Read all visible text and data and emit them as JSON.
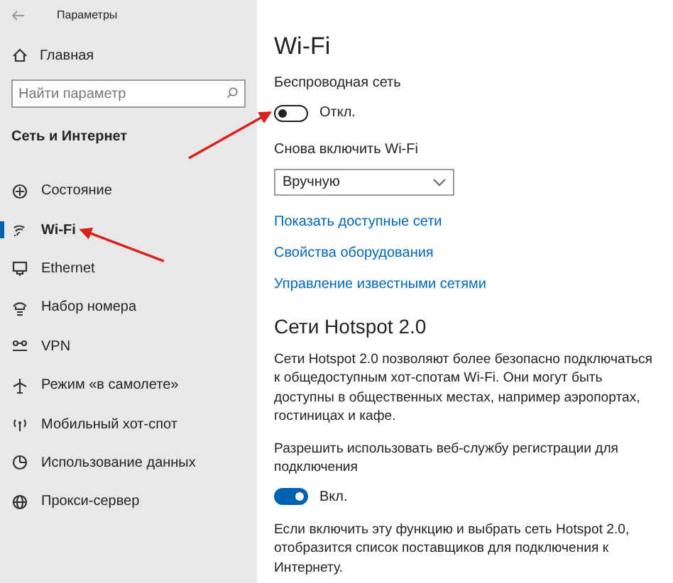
{
  "window": {
    "title": "Параметры"
  },
  "sidebar": {
    "home": "Главная",
    "search": {
      "placeholder": "Найти параметр"
    },
    "section": "Сеть и Интернет",
    "items": [
      {
        "label": "Состояние",
        "selected": false
      },
      {
        "label": "Wi-Fi",
        "selected": true
      },
      {
        "label": "Ethernet",
        "selected": false
      },
      {
        "label": "Набор номера",
        "selected": false
      },
      {
        "label": "VPN",
        "selected": false
      },
      {
        "label": "Режим «в самолете»",
        "selected": false
      },
      {
        "label": "Мобильный хот-спот",
        "selected": false
      },
      {
        "label": "Использование данных",
        "selected": false
      },
      {
        "label": "Прокси-сервер",
        "selected": false
      }
    ]
  },
  "main": {
    "title": "Wi-Fi",
    "wireless": {
      "label": "Беспроводная сеть",
      "on": false,
      "state": "Откл."
    },
    "reenable": {
      "label": "Снова включить Wi-Fi",
      "value": "Вручную"
    },
    "links": [
      "Показать доступные сети",
      "Свойства оборудования",
      "Управление известными сетями"
    ],
    "hotspot": {
      "title": "Сети Hotspot 2.0",
      "description": "Сети Hotspot 2.0 позволяют более безопасно подключаться к общедоступным хот-спотам Wi-Fi. Они могут быть доступны в общественных местах, например аэропортах, гостиницах и кафе.",
      "allow": {
        "label": "Разрешить использовать веб-службу регистрации для подключения",
        "on": true,
        "state": "Вкл."
      },
      "note": "Если включить эту функцию и выбрать сеть Hotspot 2.0, отобразится список поставщиков для подключения к Интернету."
    }
  },
  "annotations": [
    {
      "kind": "arrow"
    },
    {
      "kind": "arrow"
    }
  ]
}
